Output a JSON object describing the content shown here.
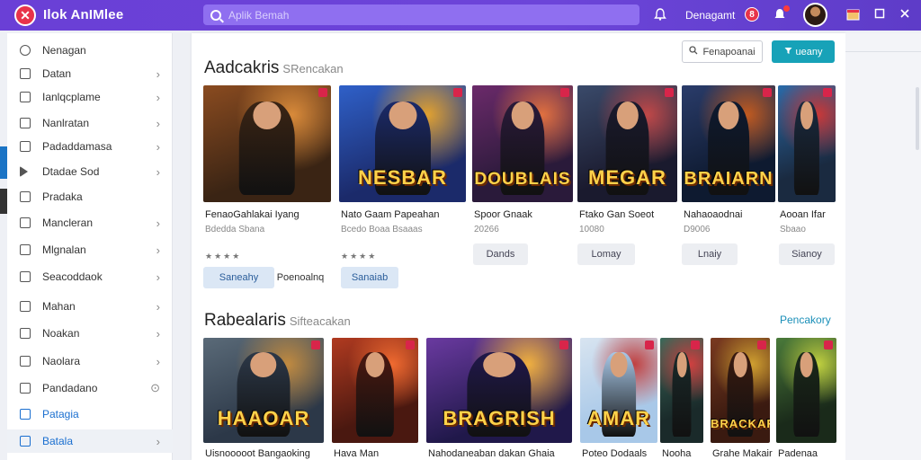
{
  "topbar": {
    "logo_glyph": "✕",
    "app_title": "Ilok AnIMlee",
    "search_placeholder": "Aplik Bemah",
    "user_label": "Denagamt",
    "notif_glyph": "8",
    "icons": [
      "bell-icon",
      "notification-icon",
      "calendar-icon",
      "maximize-icon",
      "close-icon"
    ]
  },
  "sidebar": {
    "items": [
      {
        "label": "Nenagan",
        "icon": "circle-icon",
        "chevron": false
      },
      {
        "label": "Datan",
        "icon": "folder-icon",
        "chevron": true
      },
      {
        "label": "Ianlqcplame",
        "icon": "user-icon",
        "chevron": true
      },
      {
        "label": "Nanlratan",
        "icon": "box-icon",
        "chevron": true
      },
      {
        "label": "Padaddamasa",
        "icon": "gamepad-icon",
        "chevron": true
      },
      {
        "label": "Dtadae Sod",
        "icon": "play-icon",
        "chevron": true
      },
      {
        "label": "Pradaka",
        "icon": "doc-icon",
        "chevron": false
      },
      {
        "label": "Mancleran",
        "icon": "doc-icon",
        "chevron": true
      },
      {
        "label": "Mlgnalan",
        "icon": "star-icon",
        "chevron": true
      },
      {
        "label": "Seacoddaok",
        "icon": "doc-icon",
        "chevron": true
      },
      {
        "label": "Mahan",
        "icon": "user-icon",
        "chevron": true
      },
      {
        "label": "Noakan",
        "icon": "doc-icon",
        "chevron": true
      },
      {
        "label": "Naolara",
        "icon": "doc-icon",
        "chevron": true
      },
      {
        "label": "Pandadano",
        "icon": "doc-icon",
        "chevron": false,
        "info": true
      },
      {
        "label": "Patagia",
        "icon": "doc-icon",
        "chevron": false
      },
      {
        "label": "Batala",
        "icon": "grid-icon",
        "chevron": true
      }
    ],
    "info_glyph": "⊙"
  },
  "section1": {
    "title": "Aadcakris",
    "subtitle": "SRencakan",
    "filter_button": "Fenapoanai",
    "primary_button": "ueany",
    "cards": [
      {
        "name": "FenaoGahlakai Iyang",
        "meta": "Bdedda Sbana",
        "rating": "★★★★",
        "art_title": "",
        "colors": [
          "#3a2414",
          "#8a4b20",
          "#d88a3a"
        ]
      },
      {
        "name": "Nato Gaam Papeahan",
        "meta": "Bcedo Boaa Bsaaas",
        "rating": "★★★★",
        "art_title": "NESBAR",
        "colors": [
          "#1b2a6a",
          "#2f60c8",
          "#e0a030"
        ]
      },
      {
        "name": "Spoor Gnaak",
        "meta": "20266",
        "rating": "",
        "art_title": "DOUBLAIS",
        "colors": [
          "#2a1a3a",
          "#6b2a6a",
          "#e07040"
        ]
      },
      {
        "name": "Ftako Gan Soeot",
        "meta": "10080",
        "rating": "",
        "art_title": "MEGAR",
        "colors": [
          "#1a1a2e",
          "#3a4a6a",
          "#c04848"
        ]
      },
      {
        "name": "Nahaoaodnai",
        "meta": "D9006",
        "rating": "",
        "art_title": "BRAIARN",
        "colors": [
          "#0e1a30",
          "#2a3c6a",
          "#c05a20"
        ]
      },
      {
        "name": "Aooan Ifar",
        "meta": "Sbaao",
        "rating": "",
        "art_title": "",
        "colors": [
          "#1a2a40",
          "#2a6aa8",
          "#c83838"
        ]
      }
    ],
    "card_buttons": [
      {
        "label": "Saneahy",
        "style": "blue"
      },
      {
        "label": "Poenoalnq",
        "style": "plain"
      },
      {
        "label": "Sanaiab",
        "style": "blue"
      },
      {
        "label": "Dands",
        "style": "grey"
      },
      {
        "label": "Lomay",
        "style": "grey"
      },
      {
        "label": "Lnaiy",
        "style": "grey"
      },
      {
        "label": "Sianoy",
        "style": "grey"
      }
    ]
  },
  "section2": {
    "title": "Rabealaris",
    "subtitle": "Sifteacakan",
    "link": "Pencakory",
    "cards": [
      {
        "name": "Uisnooooot Bangaoking",
        "art_title": "HAAOAR",
        "colors": [
          "#2c3848",
          "#5a6a78",
          "#c08a40"
        ]
      },
      {
        "name": "Hava Man",
        "art_title": "",
        "colors": [
          "#4a1810",
          "#b03a20",
          "#f06a30"
        ]
      },
      {
        "name": "Nahodaneaban dakan Ghaia",
        "art_title": "BRAGRISH",
        "colors": [
          "#20184a",
          "#6a3aa0",
          "#f0b040"
        ]
      },
      {
        "name": "Poteo Dodaals",
        "art_title": "AMAR",
        "colors": [
          "#a8c8e8",
          "#d8e4f0",
          "#c04040"
        ]
      },
      {
        "name": "Nooha",
        "art_title": "",
        "colors": [
          "#1a2a2a",
          "#3a6a5a",
          "#d04040"
        ]
      },
      {
        "name": "Grahe Makair",
        "art_title": "BRACKAR",
        "colors": [
          "#3a1a10",
          "#7a3a20",
          "#d0a030"
        ]
      },
      {
        "name": "Padenaa",
        "art_title": "",
        "colors": [
          "#1a2a1a",
          "#4a7a3a",
          "#c0d040"
        ]
      }
    ]
  }
}
